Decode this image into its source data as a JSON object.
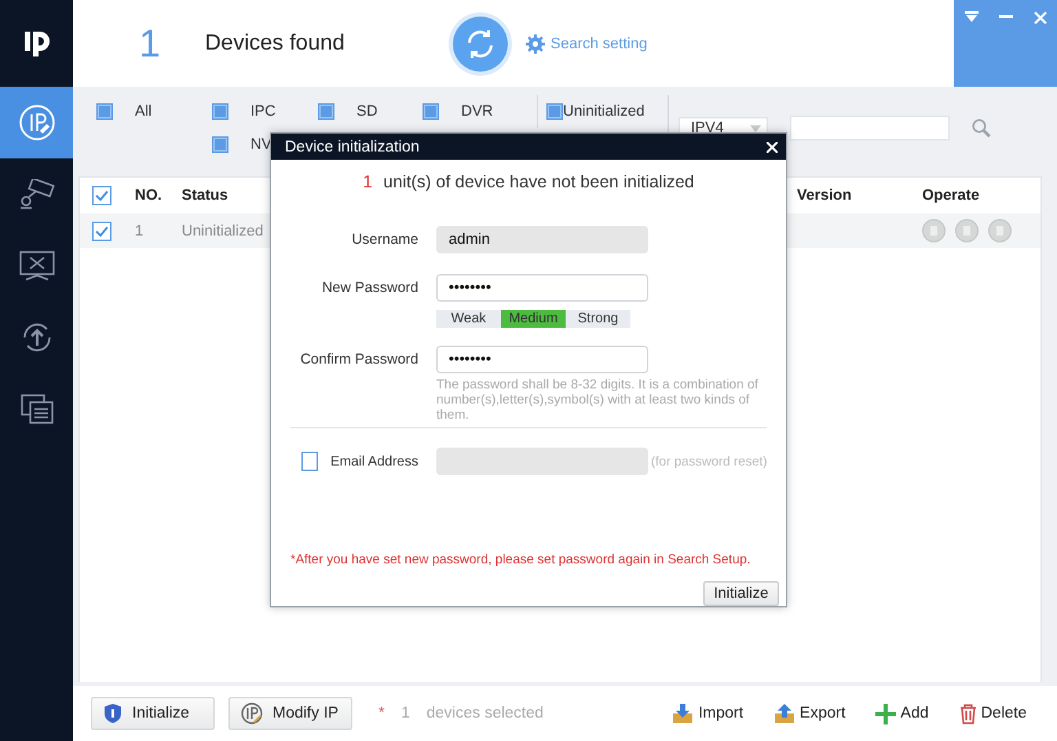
{
  "header": {
    "device_count": "1",
    "devices_found": "Devices found",
    "search_setting": "Search setting"
  },
  "sidebar": {
    "items": [
      {
        "kind": "ip",
        "selected": true
      },
      {
        "kind": "camera",
        "selected": false
      },
      {
        "kind": "tools",
        "selected": false
      },
      {
        "kind": "upgrade",
        "selected": false
      },
      {
        "kind": "windows",
        "selected": false
      }
    ]
  },
  "filters": [
    {
      "label": "All",
      "checked": true
    },
    {
      "label": "IPC",
      "checked": true
    },
    {
      "label": "SD",
      "checked": true
    },
    {
      "label": "DVR",
      "checked": true
    },
    {
      "label": "Uninitialized",
      "checked": true
    },
    {
      "label": "NV",
      "checked": true
    }
  ],
  "ip_version": "IPV4",
  "table": {
    "header_checked": true,
    "columns": [
      "NO.",
      "Status",
      "Version",
      "Operate"
    ],
    "rows": [
      {
        "checked": true,
        "no": "1",
        "status": "Uninitialized"
      }
    ]
  },
  "dialog": {
    "title": "Device initialization",
    "count": "1",
    "message": "unit(s) of device have not been initialized",
    "username_label": "Username",
    "username": "admin",
    "new_password_label": "New Password",
    "new_password": "••••••••",
    "strength": [
      {
        "label": "Weak",
        "selected": false
      },
      {
        "label": "Medium",
        "selected": true
      },
      {
        "label": "Strong",
        "selected": false
      }
    ],
    "confirm_label": "Confirm Password",
    "confirm_password": "••••••••",
    "hint": "The password shall be 8-32 digits. It is a combination of number(s),letter(s),symbol(s) with at least two kinds of them.",
    "email_label": "Email Address",
    "email_checked": false,
    "email_note": "(for password reset)",
    "warning": "*After you have set new password, please set password again in Search Setup.",
    "button": "Initialize"
  },
  "bottom": {
    "buttons": [
      {
        "kind": "initialize",
        "label": "Initialize"
      },
      {
        "kind": "modify-ip",
        "label": "Modify IP"
      }
    ],
    "selected_mark": "*",
    "selected_count": "1",
    "selected_text": "devices selected",
    "actions": [
      {
        "kind": "import",
        "label": "Import"
      },
      {
        "kind": "export",
        "label": "Export"
      },
      {
        "kind": "add",
        "label": "Add"
      },
      {
        "kind": "delete",
        "label": "Delete"
      }
    ]
  }
}
